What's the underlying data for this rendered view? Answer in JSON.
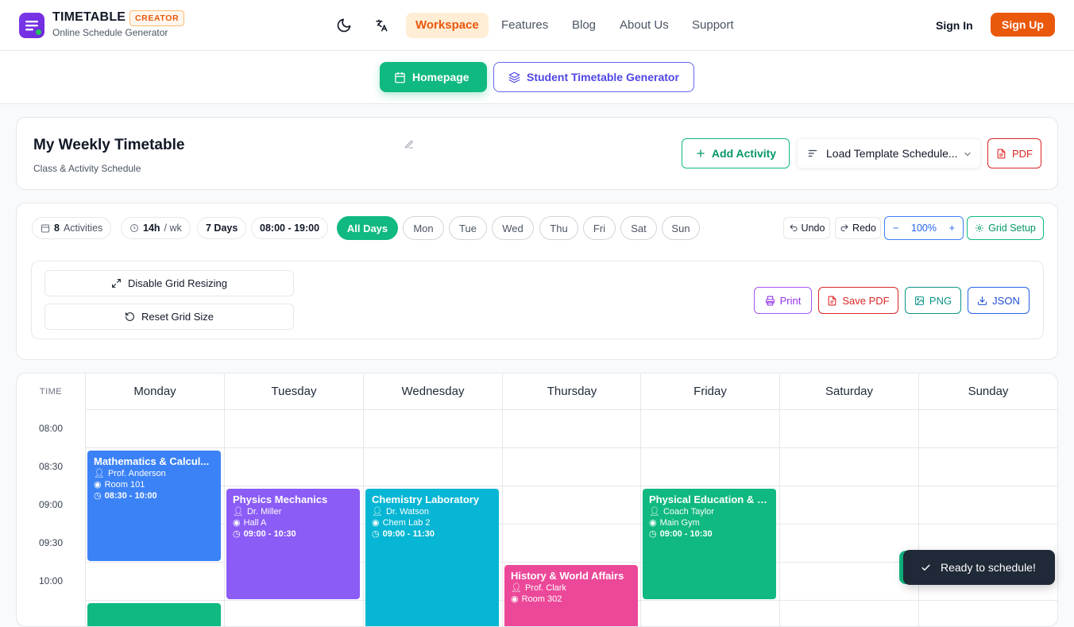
{
  "nav": {
    "brand": "TIMETABLE",
    "badge": "CREATOR",
    "tagline": "Online Schedule Generator",
    "icons": [
      "moon-icon",
      "translate-icon"
    ],
    "links": [
      "Workspace",
      "Features",
      "Blog",
      "About Us",
      "Support"
    ],
    "active_link": "Workspace",
    "sign_in": "Sign In",
    "sign_up": "Sign Up",
    "accent": "#ea580c"
  },
  "subnav": {
    "homepage": "Homepage",
    "student": "Student Timetable Generator"
  },
  "header": {
    "title": "My Weekly Timetable",
    "subtitle": "Class & Activity Schedule",
    "add_activity": "Add Activity",
    "load_template": "Load Template Schedule...",
    "pdf": "PDF"
  },
  "stats": {
    "activities_count": "8",
    "activities_label": "Activities",
    "hours": "14h",
    "hours_unit": "/ wk",
    "days": "7 Days",
    "range": "08:00 - 19:00"
  },
  "day_filters": [
    "All Days",
    "Mon",
    "Tue",
    "Wed",
    "Thu",
    "Fri",
    "Sat",
    "Sun"
  ],
  "controls": {
    "undo": "Undo",
    "redo": "Redo",
    "zoom_minus": "−",
    "zoom": "100%",
    "zoom_plus": "+",
    "grid_setup": "Grid Setup"
  },
  "grid_tools": {
    "disable_resizing": "Disable Grid Resizing",
    "reset_size": "Reset Grid Size",
    "print": "Print",
    "save_pdf": "Save PDF",
    "png": "PNG",
    "json": "JSON"
  },
  "schedule": {
    "time_header": "TIME",
    "days": [
      "Monday",
      "Tuesday",
      "Wednesday",
      "Thursday",
      "Friday",
      "Saturday",
      "Sunday"
    ],
    "times": [
      "08:00",
      "08:30",
      "09:00",
      "09:30",
      "10:00"
    ],
    "events": [
      {
        "title": "Mathematics & Calcul...",
        "person": "Prof. Anderson",
        "room": "Room 101",
        "time": "08:30 - 10:00",
        "color": "#3b82f6"
      },
      {
        "title": "Physics Mechanics",
        "person": "Dr. Miller",
        "room": "Hall A",
        "time": "09:00 - 10:30",
        "color": "#8b5cf6"
      },
      {
        "title": "Chemistry Laboratory",
        "person": "Dr. Watson",
        "room": "Chem Lab 2",
        "time": "09:00 - 11:30",
        "color": "#06b6d4"
      },
      {
        "title": "History & World Affairs",
        "person": "Prof. Clark",
        "room": "Room 302",
        "time": "",
        "color": "#ec4899"
      },
      {
        "title": "Physical Education & Fi...",
        "person": "Coach Taylor",
        "room": "Main Gym",
        "time": "09:00 - 10:30",
        "color": "#10b981"
      }
    ]
  },
  "toast": {
    "message": "Ready to schedule!"
  }
}
